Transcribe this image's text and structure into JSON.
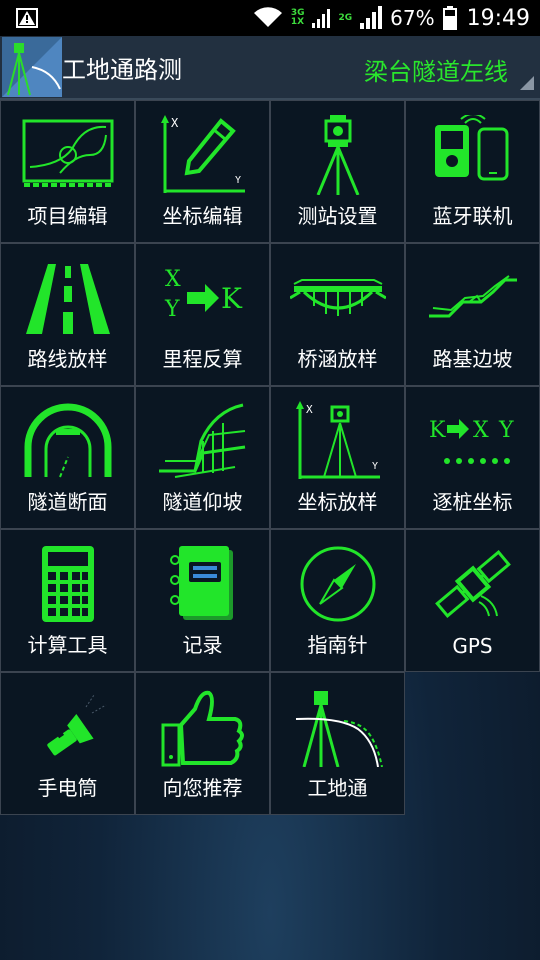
{
  "status_bar": {
    "network_top": "3G",
    "network_bottom": "1X",
    "network2": "2G",
    "battery": "67%",
    "time": "19:49"
  },
  "app_bar": {
    "title": "工地通路测",
    "project": "梁台隧道左线",
    "accent": "#29e62c"
  },
  "tiles": [
    {
      "label": "项目编辑",
      "icon": "curve-design-icon"
    },
    {
      "label": "坐标编辑",
      "icon": "coordinate-edit-icon"
    },
    {
      "label": "测站设置",
      "icon": "total-station-icon"
    },
    {
      "label": "蓝牙联机",
      "icon": "bluetooth-link-icon"
    },
    {
      "label": "路线放样",
      "icon": "road-icon"
    },
    {
      "label": "里程反算",
      "icon": "xy-to-k-icon"
    },
    {
      "label": "桥涵放样",
      "icon": "bridge-icon"
    },
    {
      "label": "路基边坡",
      "icon": "slope-icon"
    },
    {
      "label": "隧道断面",
      "icon": "tunnel-section-icon"
    },
    {
      "label": "隧道仰坡",
      "icon": "tunnel-slope-icon"
    },
    {
      "label": "坐标放样",
      "icon": "coordinate-stakeout-icon"
    },
    {
      "label": "逐桩坐标",
      "icon": "k-to-xy-icon"
    },
    {
      "label": "计算工具",
      "icon": "calculator-icon"
    },
    {
      "label": "记录",
      "icon": "notebook-icon"
    },
    {
      "label": "指南针",
      "icon": "compass-icon"
    },
    {
      "label": "GPS",
      "icon": "satellite-icon"
    },
    {
      "label": "手电筒",
      "icon": "flashlight-icon"
    },
    {
      "label": "向您推荐",
      "icon": "thumbs-up-icon"
    },
    {
      "label": "工地通",
      "icon": "site-survey-icon"
    }
  ],
  "icon_text": {
    "x": "X",
    "y": "Y",
    "k": "K"
  }
}
